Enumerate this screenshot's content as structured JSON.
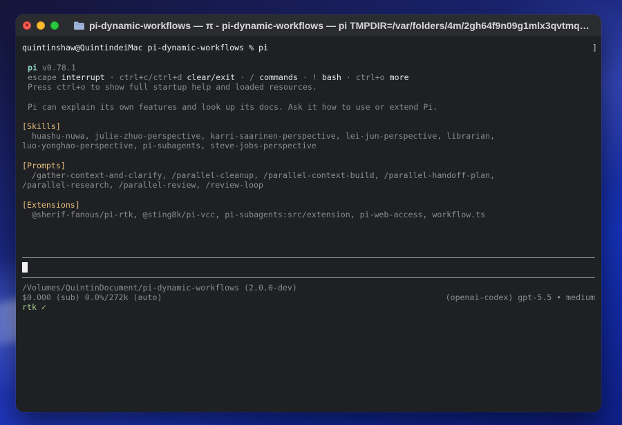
{
  "window": {
    "title": "pi-dynamic-workflows — π - pi-dynamic-workflows — pi TMPDIR=/var/folders/4m/2gh64f9n09g1mlx3qvtmqzp..."
  },
  "terminal": {
    "prompt": "quintinshaw@QuintindeiMac pi-dynamic-workflows % pi",
    "header": {
      "name": "pi",
      "version": "v0.78.1"
    },
    "shortcuts": [
      {
        "key": "escape",
        "label": "interrupt"
      },
      {
        "key": "ctrl+c/ctrl+d",
        "label": "clear/exit"
      },
      {
        "key": "/",
        "label": "commands"
      },
      {
        "key": "!",
        "label": "bash"
      },
      {
        "key": "ctrl+o",
        "label": "more"
      }
    ],
    "hint": "Press ctrl+o to show full startup help and loaded resources.",
    "intro": "Pi can explain its own features and look up its docs. Ask it how to use or extend Pi.",
    "skills": {
      "heading": "[Skills]",
      "line1": "huashu-nuwa, julie-zhuo-perspective, karri-saarinen-perspective, lei-jun-perspective, librarian,",
      "line2": "luo-yonghao-perspective, pi-subagents, steve-jobs-perspective"
    },
    "prompts": {
      "heading": "[Prompts]",
      "line1": "/gather-context-and-clarify, /parallel-cleanup, /parallel-context-build, /parallel-handoff-plan,",
      "line2": "/parallel-research, /parallel-review, /review-loop"
    },
    "extensions": {
      "heading": "[Extensions]",
      "line1": "@sherif-fanous/pi-rtk, @sting8k/pi-vcc, pi-subagents:src/extension, pi-web-access, workflow.ts"
    },
    "footer": {
      "path": "/Volumes/QuintinDocument/pi-dynamic-workflows (2.0.0-dev)",
      "usage": "$0.000 (sub) 0.0%/272k (auto)",
      "model": "(openai-codex) gpt-5.5 • medium",
      "rtk": "rtk ✓"
    }
  },
  "colors": {
    "window_bg": "#1f2024",
    "section_heading": "#e6c07b",
    "pi_name": "#8fd6c9",
    "rtk_ok": "#a6d189"
  }
}
